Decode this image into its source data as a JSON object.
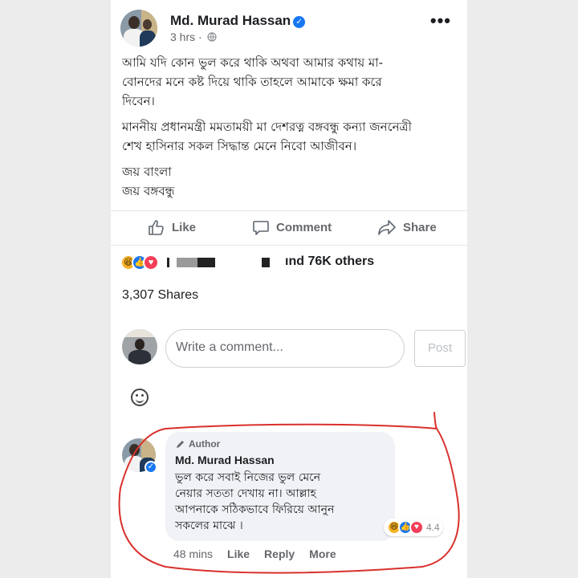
{
  "post": {
    "author": "Md. Murad Hassan",
    "time": "3 hrs ·",
    "body": {
      "paragraphs": [
        [
          "আমি যদি কোন ভুল করে থাকি অথবা আমার কথায় মা-",
          "বোনদের মনে কষ্ট দিয়ে থাকি তাহলে আমাকে ক্ষমা করে",
          "দিবেন।"
        ],
        [
          "মাননীয় প্রধানমন্ত্রী মমতাময়ী মা দেশরত্ন বঙ্গবন্ধু কন্যা জননেত্রী",
          "শেখ হাসিনার সকল সিদ্ধান্ত মেনে নিবো আজীবন।"
        ],
        [
          "জয় বাংলা",
          "জয় বঙ্গবন্ধু"
        ]
      ]
    },
    "actions": {
      "like": "Like",
      "comment": "Comment",
      "share": "Share"
    },
    "reactions_text": "ınd 76K others",
    "shares": "3,307 Shares"
  },
  "composer": {
    "placeholder": "Write a comment...",
    "post_button": "Post"
  },
  "comment": {
    "badge": "Author",
    "author": "Md. Murad Hassan",
    "lines": [
      "ভুল করে সবাই নিজের ভুল মেনে",
      "নেয়ার সততা দেখায় না। আল্লাহ",
      "আপনাকে সঠিকভাবে ফিরিয়ে আনুন",
      "সকলের মাঝে ।"
    ],
    "reaction_count": "4.4",
    "time": "48 mins",
    "like": "Like",
    "reply": "Reply",
    "more": "More"
  },
  "colors": {
    "brand": "#1877f2",
    "text": "#1c1e21",
    "secondary": "#65676b",
    "annotation": "#d9302c"
  }
}
